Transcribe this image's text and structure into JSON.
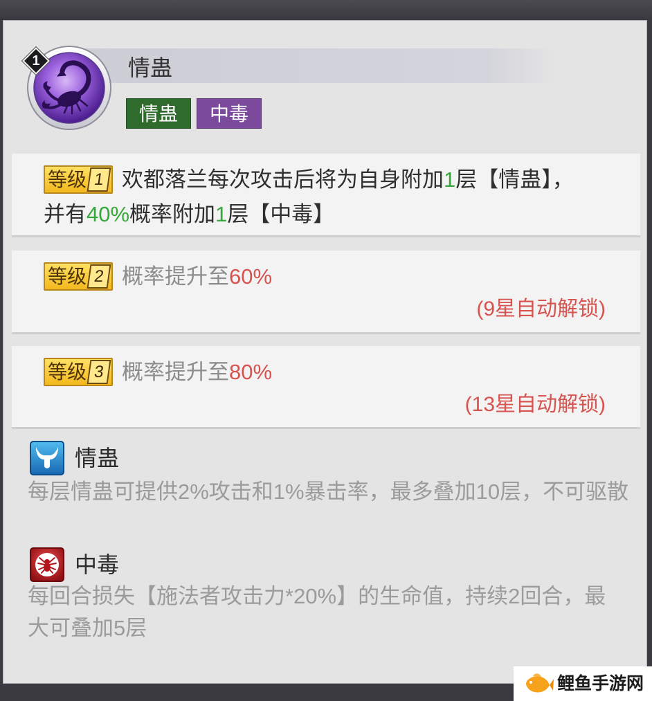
{
  "skill": {
    "rank": "1",
    "icon": "scorpion-icon",
    "name": "情蛊",
    "tags": [
      {
        "label": "情蛊",
        "color": "#2f6b2d"
      },
      {
        "label": "中毒",
        "color": "#7b4a9d"
      }
    ]
  },
  "levels": [
    {
      "badge_label": "等级",
      "level": "1",
      "text_color": "#2f2f2f",
      "segments": [
        {
          "text": "欢都落兰每次攻击后将为自身附加"
        },
        {
          "text": "1",
          "color": "#36a83b"
        },
        {
          "text": "层【情蛊】，并有"
        },
        {
          "text": "40%",
          "color": "#36a83b"
        },
        {
          "text": "概率附加"
        },
        {
          "text": "1",
          "color": "#36a83b"
        },
        {
          "text": "层【中毒】"
        }
      ]
    },
    {
      "badge_label": "等级",
      "level": "2",
      "text_color": "#8c8c8c",
      "segments": [
        {
          "text": "概率提升至"
        },
        {
          "text": "60%",
          "color": "#d6534f"
        }
      ],
      "unlock_hint": "(9星自动解锁)",
      "unlock_hint_color": "#d6534f"
    },
    {
      "badge_label": "等级",
      "level": "3",
      "text_color": "#8c8c8c",
      "segments": [
        {
          "text": "概率提升至"
        },
        {
          "text": "80%",
          "color": "#d6534f"
        }
      ],
      "unlock_hint": "(13星自动解锁)",
      "unlock_hint_color": "#d6534f"
    }
  ],
  "buffs": [
    {
      "icon": "bull-horns-icon",
      "name": "情蛊",
      "description": "每层情蛊可提供2%攻击和1%暴击率，最多叠加10层，不可驱散"
    },
    {
      "icon": "spider-icon",
      "name": "中毒",
      "description": "每回合损失【施法者攻击力*20%】的生命值，持续2回合，最大可叠加5层"
    }
  ],
  "watermark": {
    "logo": "carp-fish-logo",
    "text": "鲤鱼手游网"
  }
}
